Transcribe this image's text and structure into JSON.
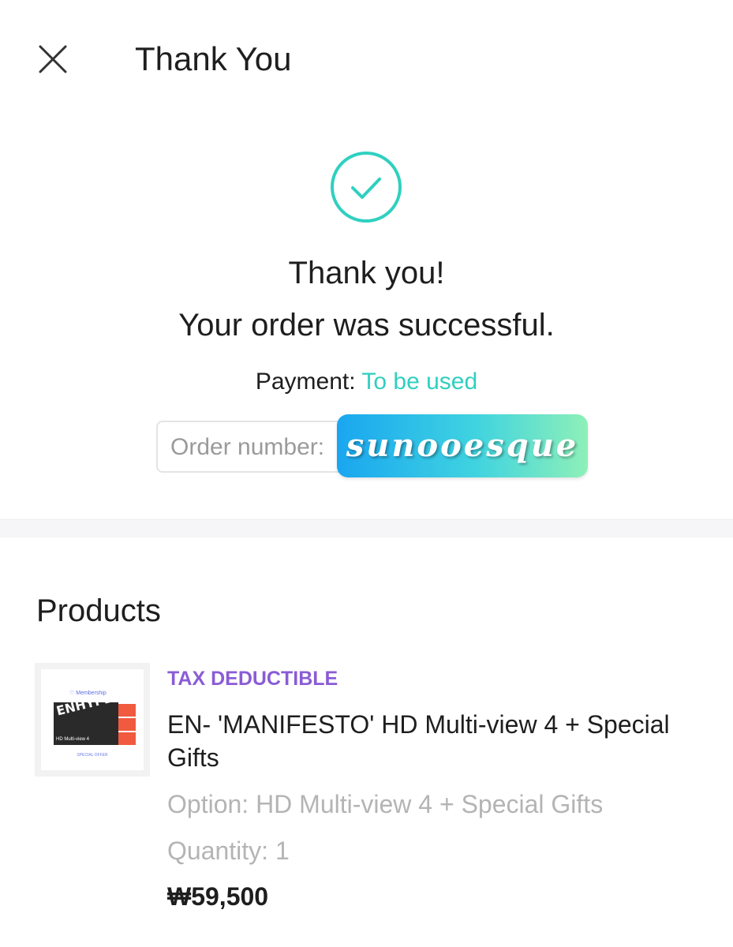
{
  "header": {
    "title": "Thank You",
    "close_icon": "close-icon"
  },
  "confirmation": {
    "status_icon": "check-circle-icon",
    "accent_color": "#2fd0c0",
    "line1": "Thank you!",
    "line2": "Your order was successful.",
    "payment_label": "Payment: ",
    "payment_value": "To be used",
    "order_label": "Order number: "
  },
  "watermark": {
    "text": "sunooesque"
  },
  "products": {
    "section_title": "Products",
    "items": [
      {
        "badge": "TAX DEDUCTIBLE",
        "badge_color": "#8a5cd6",
        "name": "EN- 'MANIFESTO' HD Multi-view 4 + Special Gifts",
        "option": "Option: HD Multi-view 4 + Special Gifts",
        "quantity": "Quantity: 1",
        "price": "₩59,500",
        "thumbnail": {
          "brand": "Membership",
          "photo_text": "ENHYPEN",
          "photo_sub": "HD Multi-view 4",
          "footer": "SPECIAL OFFER"
        }
      }
    ]
  }
}
